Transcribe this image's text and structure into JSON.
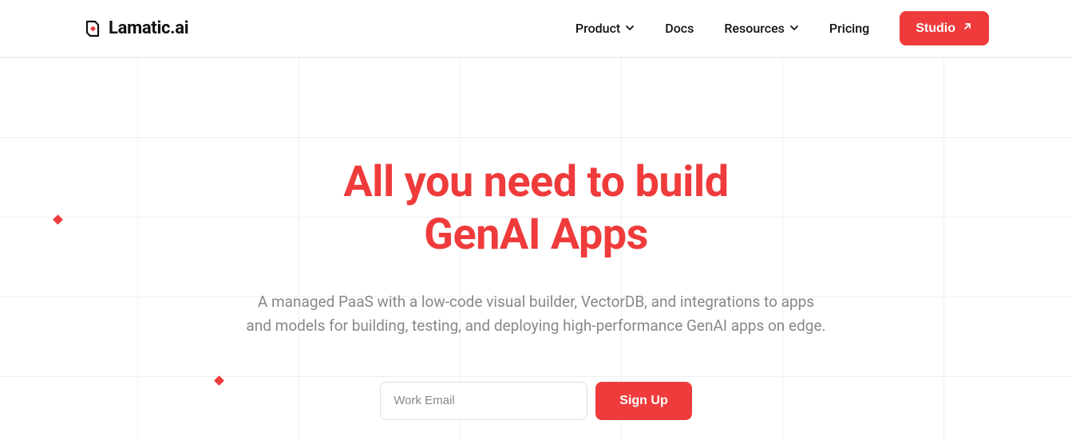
{
  "brand": {
    "name": "Lamatic.ai",
    "accent": "#ef3b3b"
  },
  "nav": {
    "items": [
      {
        "label": "Product",
        "has_dropdown": true
      },
      {
        "label": "Docs",
        "has_dropdown": false
      },
      {
        "label": "Resources",
        "has_dropdown": true
      },
      {
        "label": "Pricing",
        "has_dropdown": false
      }
    ],
    "cta": {
      "label": "Studio"
    }
  },
  "hero": {
    "title_line1": "All you need to build",
    "title_line2": "GenAI Apps",
    "subtitle": "A managed PaaS with a low-code visual builder, VectorDB, and integrations to apps and models for building, testing, and deploying high-performance GenAI apps on edge."
  },
  "signup": {
    "email_placeholder": "Work Email",
    "button_label": "Sign Up"
  }
}
